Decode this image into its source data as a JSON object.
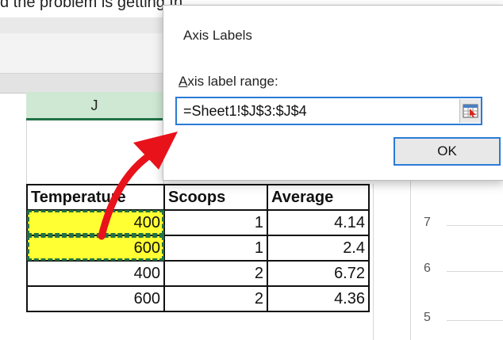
{
  "top_text": "d the problem is getting th",
  "column_header": "J",
  "dialog": {
    "title": "Axis Labels",
    "range_label_prefix": "A",
    "range_label_rest": "xis label range:",
    "range_value": "=Sheet1!$J$3:$J$4",
    "range_button_icon": "collapse-dialog-icon",
    "ok_label": "OK"
  },
  "table": {
    "headers": [
      "Temperature",
      "Scoops",
      "Average"
    ],
    "rows": [
      {
        "temperature": "400",
        "scoops": "1",
        "average": "4.14"
      },
      {
        "temperature": "600",
        "scoops": "1",
        "average": "2.4"
      },
      {
        "temperature": "400",
        "scoops": "2",
        "average": "6.72"
      },
      {
        "temperature": "600",
        "scoops": "2",
        "average": "4.36"
      }
    ]
  },
  "chart_axis": {
    "ticks": [
      "7",
      "6",
      "5"
    ]
  },
  "colors": {
    "highlight": "#ffff33",
    "selection": "#217346",
    "arrow": "#e8121b",
    "accent": "#2b7bd6"
  }
}
